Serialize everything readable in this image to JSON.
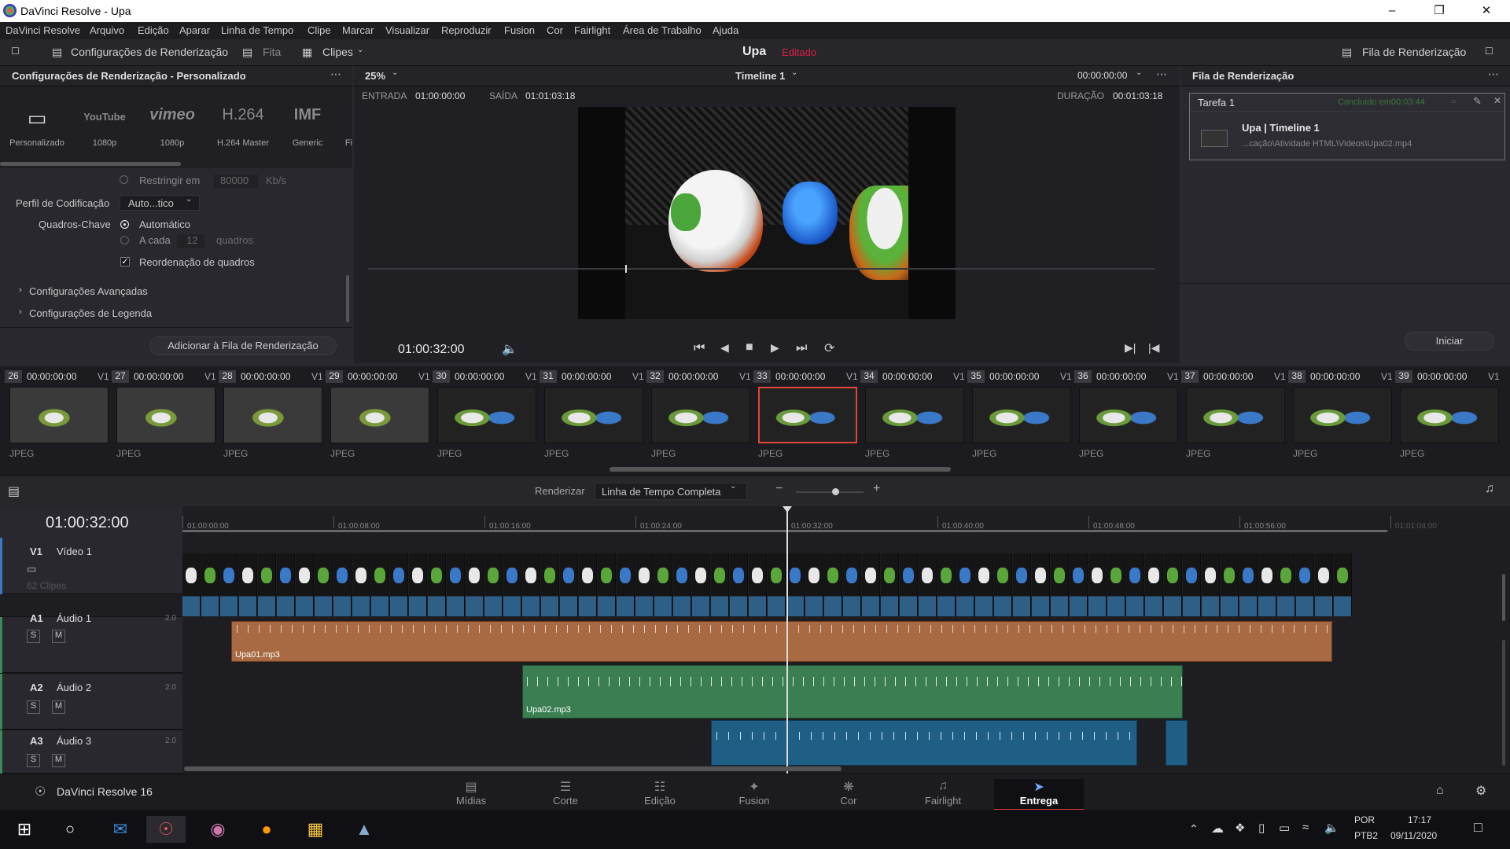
{
  "window": {
    "title": "DaVinci Resolve - Upa"
  },
  "menu": [
    "DaVinci Resolve",
    "Arquivo",
    "Edição",
    "Aparar",
    "Linha de Tempo",
    "Clipe",
    "Marcar",
    "Visualizar",
    "Reproduzir",
    "Fusion",
    "Cor",
    "Fairlight",
    "Área de Trabalho",
    "Ajuda"
  ],
  "toolbar": {
    "render_settings": "Configurações de Renderização",
    "tape": "Fita",
    "clips": "Clipes",
    "project": "Upa",
    "edited": "Editado",
    "render_queue": "Fila de Renderização"
  },
  "left": {
    "title": "Configurações de Renderização - Personalizado",
    "presets": [
      {
        "logo": "▭",
        "label": "Personalizado"
      },
      {
        "logo": "YouTube",
        "label": "1080p"
      },
      {
        "logo": "vimeo",
        "label": "1080p"
      },
      {
        "logo": "H.264",
        "label": "H.264 Master"
      },
      {
        "logo": "IMF",
        "label": "Generic"
      },
      {
        "logo": "",
        "label": "Fi"
      }
    ],
    "restrict_label": "Restringir em",
    "restrict_value": "80000",
    "restrict_unit": "Kb/s",
    "profile_label": "Perfil de Codificação",
    "profile_value": "Auto...tico",
    "keyframes_label": "Quadros-Chave",
    "auto": "Automático",
    "every": "A cada",
    "every_value": "12",
    "frames": "quadros",
    "reorder": "Reordenação de quadros",
    "advanced": "Configurações Avançadas",
    "subtitles": "Configurações de Legenda",
    "add_button": "Adicionar à Fila de Renderização"
  },
  "viewer": {
    "zoom": "25%",
    "timeline": "Timeline 1",
    "tc_top": "00:00:00:00",
    "in_label": "ENTRADA",
    "in_value": "01:00:00:00",
    "out_label": "SAÍDA",
    "out_value": "01:01:03:18",
    "dur_label": "DURAÇÃO",
    "dur_value": "00:01:03:18",
    "timecode": "01:00:32:00"
  },
  "queue": {
    "title": "Fila de Renderização",
    "job": "Tarefa 1",
    "status": "Concluído em00:03:44",
    "name": "Upa | Timeline 1",
    "path": "...cação\\Atividade HTML\\Videos\\Upa02.mp4",
    "start": "Iniciar"
  },
  "clips": [
    {
      "num": "26",
      "tc": "00:00:00:00",
      "trk": "V1",
      "fmt": "JPEG",
      "v": "a"
    },
    {
      "num": "27",
      "tc": "00:00:00:00",
      "trk": "V1",
      "fmt": "JPEG",
      "v": "a"
    },
    {
      "num": "28",
      "tc": "00:00:00:00",
      "trk": "V1",
      "fmt": "JPEG",
      "v": "a"
    },
    {
      "num": "29",
      "tc": "00:00:00:00",
      "trk": "V1",
      "fmt": "JPEG",
      "v": "a"
    },
    {
      "num": "30",
      "tc": "00:00:00:00",
      "trk": "V1",
      "fmt": "JPEG",
      "v": "b"
    },
    {
      "num": "31",
      "tc": "00:00:00:00",
      "trk": "V1",
      "fmt": "JPEG",
      "v": "b"
    },
    {
      "num": "32",
      "tc": "00:00:00:00",
      "trk": "V1",
      "fmt": "JPEG",
      "v": "b"
    },
    {
      "num": "33",
      "tc": "00:00:00:00",
      "trk": "V1",
      "fmt": "JPEG",
      "v": "b",
      "sel": true
    },
    {
      "num": "34",
      "tc": "00:00:00:00",
      "trk": "V1",
      "fmt": "JPEG",
      "v": "b"
    },
    {
      "num": "35",
      "tc": "00:00:00:00",
      "trk": "V1",
      "fmt": "JPEG",
      "v": "b"
    },
    {
      "num": "36",
      "tc": "00:00:00:00",
      "trk": "V1",
      "fmt": "JPEG",
      "v": "b"
    },
    {
      "num": "37",
      "tc": "00:00:00:00",
      "trk": "V1",
      "fmt": "JPEG",
      "v": "b"
    },
    {
      "num": "38",
      "tc": "00:00:00:00",
      "trk": "V1",
      "fmt": "JPEG",
      "v": "b"
    },
    {
      "num": "39",
      "tc": "00:00:00:00",
      "trk": "V1",
      "fmt": "JPEG",
      "v": "b"
    }
  ],
  "render_bar": {
    "label": "Renderizar",
    "value": "Linha de Tempo Completa"
  },
  "timeline": {
    "timecode": "01:00:32:00",
    "ruler": [
      "01:00:00:00",
      "01:00:08:00",
      "01:00:16:00",
      "01:00:24:00",
      "01:00:32:00",
      "01:00:40:00",
      "01:00:48:00",
      "01:00:56:00",
      "01:01:04:00"
    ],
    "v1": {
      "id": "V1",
      "name": "Vídeo 1",
      "count": "62 Clipes"
    },
    "a1": {
      "id": "A1",
      "name": "Áudio 1",
      "ch": "2.0",
      "clip": "Upa01.mp3"
    },
    "a2": {
      "id": "A2",
      "name": "Áudio 2",
      "ch": "2.0",
      "clip": "Upa02.mp3"
    },
    "a3": {
      "id": "A3",
      "name": "Áudio 3",
      "ch": "2.0"
    },
    "s": "S",
    "m": "M"
  },
  "nav": {
    "brand": "DaVinci Resolve 16",
    "pages": [
      "Mídias",
      "Corte",
      "Edição",
      "Fusion",
      "Cor",
      "Fairlight",
      "Entrega"
    ],
    "active": "Entrega"
  },
  "tray": {
    "lang1": "POR",
    "lang2": "PTB2",
    "time": "17:17",
    "date": "09/11/2020"
  },
  "colors": {
    "audio1": "#a86a42",
    "audio2": "#3b7e52",
    "audio3": "#1f5f86",
    "video": "#2e5f86",
    "accent": "#e0453a"
  }
}
